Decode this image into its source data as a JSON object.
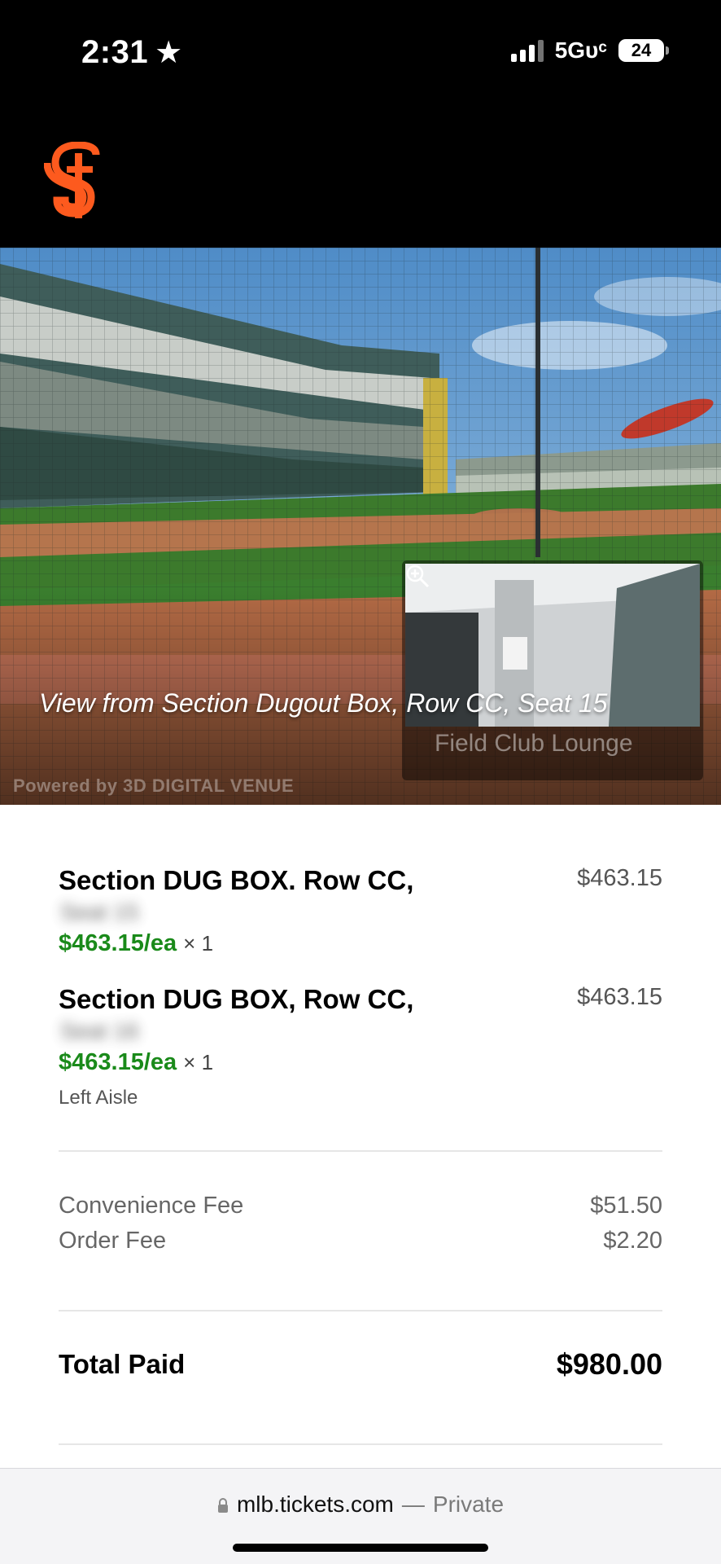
{
  "status_bar": {
    "time": "2:31",
    "network": "5Gᴜᶜ",
    "battery": "24"
  },
  "header": {
    "logo": "sf-giants-logo"
  },
  "hero": {
    "caption": "View from Section Dugout Box, Row CC, Seat 15",
    "powered_by": "Powered by 3D DIGITAL VENUE",
    "thumbnail_label": "Field Club Lounge"
  },
  "order": {
    "items": [
      {
        "title": "Section DUG BOX. Row CC,",
        "seat": "Seat 15",
        "price": "$463.15",
        "each": "$463.15/ea",
        "qty": "× 1",
        "note": ""
      },
      {
        "title": "Section DUG BOX, Row CC,",
        "seat": "Seat 16",
        "price": "$463.15",
        "each": "$463.15/ea",
        "qty": "× 1",
        "note": "Left Aisle"
      }
    ],
    "fees": [
      {
        "label": "Convenience Fee",
        "value": "$51.50"
      },
      {
        "label": "Order Fee",
        "value": "$2.20"
      }
    ],
    "total": {
      "label": "Total Paid",
      "value": "$980.00"
    }
  },
  "browser": {
    "domain": "mlb.tickets.com",
    "separator": "—",
    "mode": "Private"
  },
  "colors": {
    "accent_green": "#1a8a1a",
    "giants_orange": "#fd5a1e"
  }
}
